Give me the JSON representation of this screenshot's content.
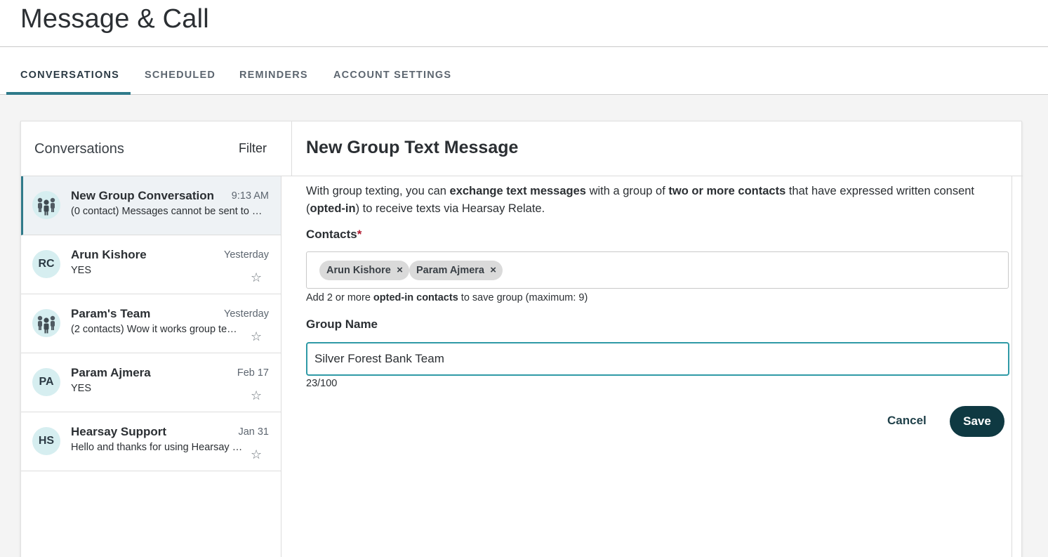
{
  "page": {
    "title": "Message & Call"
  },
  "tabs": [
    {
      "label": "CONVERSATIONS",
      "active": true
    },
    {
      "label": "SCHEDULED",
      "active": false
    },
    {
      "label": "REMINDERS",
      "active": false
    },
    {
      "label": "ACCOUNT SETTINGS",
      "active": false
    }
  ],
  "conversations_panel": {
    "title": "Conversations",
    "filter_label": "Filter",
    "items": [
      {
        "name": "New Group Conversation",
        "time": "9:13 AM",
        "preview": "(0 contact) Messages cannot be sent to …",
        "avatar": "group-icon",
        "selected": true
      },
      {
        "name": "Arun Kishore",
        "time": "Yesterday",
        "preview": "YES",
        "avatar": "RC",
        "star": "☆"
      },
      {
        "name": "Param's Team",
        "time": "Yesterday",
        "preview": "(2 contacts) Wow it works group te…",
        "avatar": "group-icon",
        "star": "☆"
      },
      {
        "name": "Param Ajmera",
        "time": "Feb 17",
        "preview": "YES",
        "avatar": "PA",
        "star": "☆"
      },
      {
        "name": "Hearsay Support",
        "time": "Jan 31",
        "preview": "Hello and thanks for using Hearsay …",
        "avatar": "HS",
        "star": "☆"
      }
    ]
  },
  "compose": {
    "title": "New Group Text Message",
    "intro": {
      "p1": "With group texting, you can ",
      "b1": "exchange text messages",
      "p2": " with a group of ",
      "b2": "two or more contacts",
      "p3": " that have expressed written consent (",
      "b3": "opted-in",
      "p4": ") to receive texts via Hearsay Relate."
    },
    "contacts_label": "Contacts",
    "required_mark": "*",
    "chips": [
      {
        "label": "Arun Kishore",
        "remove": "×"
      },
      {
        "label": "Param Ajmera",
        "remove": "×"
      }
    ],
    "helper": {
      "p1": "Add 2 or more ",
      "b1": "opted-in contacts",
      "p2": " to save group (maximum: 9)"
    },
    "group_name_label": "Group Name",
    "group_name_value": "Silver Forest Bank Team",
    "char_counter": "23/100",
    "cancel_label": "Cancel",
    "save_label": "Save"
  },
  "colors": {
    "accent": "#2f7a8a",
    "primary_button": "#0f3942",
    "input_focus": "#2f9aa6",
    "required": "#b0182e",
    "avatar_bg": "#d6eef0"
  }
}
